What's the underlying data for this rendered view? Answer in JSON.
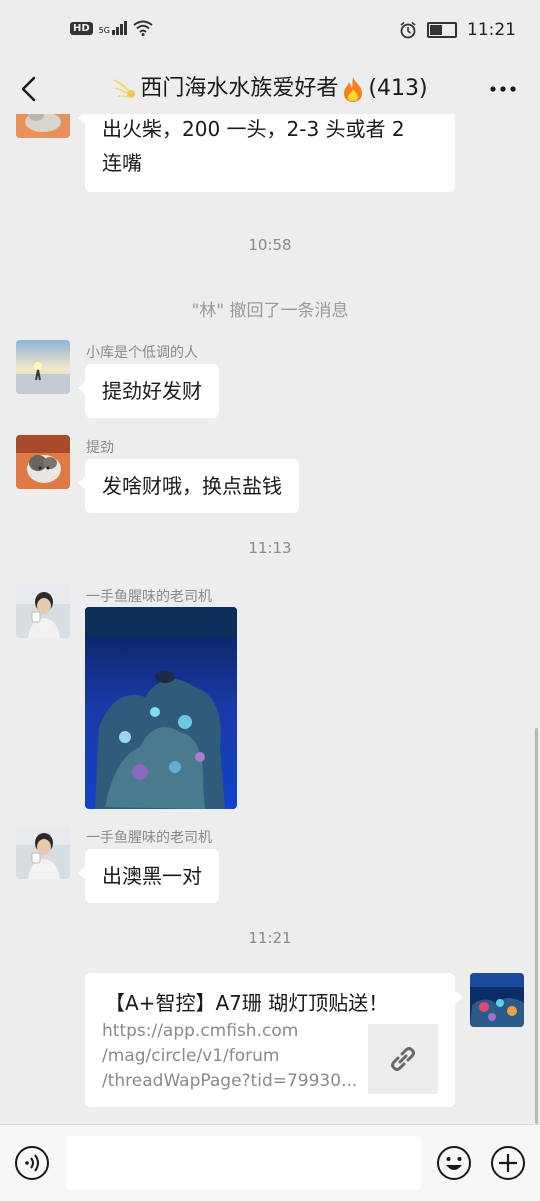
{
  "status_bar": {
    "hd_label": "HD",
    "network_label": "5G",
    "time": "11:21"
  },
  "header": {
    "title_prefix_icon": "comet-emoji",
    "title": "西门海水水族爱好者",
    "title_suffix_icon": "fire-emoji",
    "member_count": "(413)"
  },
  "messages": {
    "msg_top": {
      "line1": "出火柴，200 一头，2-3 头或者 2",
      "line2": "连嘴"
    },
    "time_1": "10:58",
    "recall_notice": "\"林\" 撤回了一条消息",
    "msg_a": {
      "sender": "小库是个低调的人",
      "text": "提劲好发财"
    },
    "msg_b": {
      "sender": "提劲",
      "text": "发啥财哦，换点盐钱"
    },
    "time_2": "11:13",
    "msg_c": {
      "sender": "一手鱼腥味的老司机",
      "image": "coral-reef-photo"
    },
    "msg_d": {
      "sender": "一手鱼腥味的老司机",
      "text": "出澳黑一对"
    },
    "time_3": "11:21",
    "link_card": {
      "title": "【A+智控】A7珊 瑚灯顶贴送！",
      "url_line1": "https://app.cmfish.com",
      "url_line2": "/mag/circle/v1/forum",
      "url_line3": "/threadWapPage?tid=79930...",
      "thumb_icon": "link-icon"
    }
  },
  "input_bar": {
    "voice_icon": "voice-icon",
    "emoji_icon": "emoji-icon",
    "plus_icon": "plus-icon"
  },
  "colors": {
    "background": "#ededed",
    "bubble": "#ffffff",
    "meta_text": "#8a8a8a"
  }
}
